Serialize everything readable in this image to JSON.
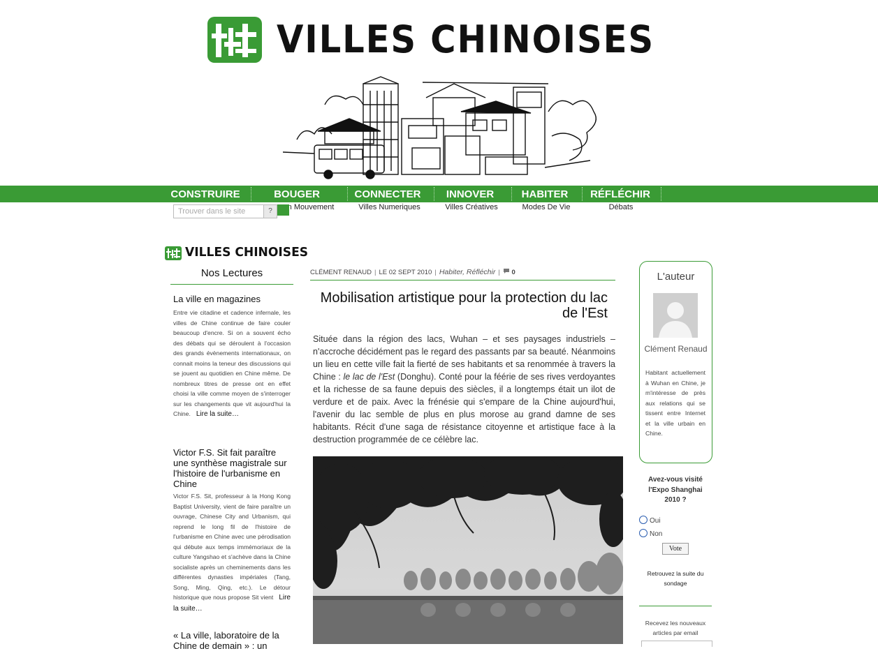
{
  "site": {
    "title": "VILLES CHINOISES",
    "accent": "#3a9b35"
  },
  "nav": {
    "items": [
      {
        "label": "CONSTRUIRE",
        "sub": ""
      },
      {
        "label": "BOUGER",
        "sub": "n Mouvement"
      },
      {
        "label": "CONNECTER",
        "sub": "Villes Numeriques"
      },
      {
        "label": "INNOVER",
        "sub": "Villes Créatives"
      },
      {
        "label": "HABITER",
        "sub": "Modes De Vie"
      },
      {
        "label": "RÉFLÉCHIR",
        "sub": "Débats"
      }
    ]
  },
  "search": {
    "placeholder": "Trouver dans le site",
    "button": "?"
  },
  "sidebar_left": {
    "logo_text": "VILLES CHINOISES",
    "section_title": "Nos Lectures",
    "items": [
      {
        "title": "La ville en magazines",
        "excerpt": "Entre vie citadine et cadence infernale, les villes de Chine continue de faire couler beaucoup d'encre. Si on a souvent écho des débats qui se déroulent à l'occasion des grands évènements internationaux, on connait moins la teneur des discussions qui se jouent au quotidien en Chine même. De nombreux titres de presse ont en effet choisi la ville comme moyen de s'interroger sur les changements que vit aujourd'hui la Chine.",
        "more": "Lire la suite…"
      },
      {
        "title": "Victor F.S. Sit fait paraître une synthèse magistrale sur l'histoire de l'urbanisme en Chine",
        "excerpt": "Victor F.S. Sit, professeur à la Hong Kong Baptist University, vient de faire paraître un ouvrage, Chinese City and Urbanism, qui reprend le long fil de l'histoire de l'urbanisme en Chine avec une pérodisation qui débute aux temps immémoriaux de la culture Yangshao et s'achève dans la Chine socialiste après un cheminements dans les différentes dynasties impériales (Tang, Song, Ming, Qing, etc.). Le détour historique que nous propose Sit vient",
        "more": "Lire la suite…"
      },
      {
        "title": "« La ville, laboratoire de la Chine de demain » : un",
        "excerpt": "",
        "more": ""
      }
    ]
  },
  "article": {
    "author": "CLÉMENT RENAUD",
    "date": "LE 02 SEPT 2010",
    "categories": "Habiter, Réfléchir",
    "comments": "0",
    "title": "Mobilisation artistique pour la protection du lac de l'Est",
    "body_1": "Située dans la région des lacs, Wuhan – et ses paysages industriels – n'accroche décidément  pas le regard des passants par sa beauté. Néanmoins un lieu en cette ville fait la fierté de ses habitants et sa renommée à travers la Chine : ",
    "body_italic": "le lac de l'Est",
    "body_2": " (Donghu). Conté pour la féérie de ses rives verdoyantes et la richesse de sa faune depuis des siècles, il a longtemps était un ilot de verdure et de paix. Avec la frénésie qui s'empare de la Chine aujourd'hui, l'avenir du lac semble de plus en plus morose au grand damne de ses habitants. Récit d'une saga de résistance citoyenne et artistique face à la destruction programmée de ce célèbre lac."
  },
  "sidebar_right": {
    "author_box_title": "L'auteur",
    "author_name": "Clément Renaud",
    "author_bio": "Habitant actuellement à Wuhan en Chine, je m'intéresse de près aux relations qui se tissent entre Internet et la ville urbain en Chine.",
    "poll": {
      "question": "Avez-vous visité l'Expo Shanghai 2010 ?",
      "options": [
        "Oui",
        "Non"
      ],
      "vote": "Vote",
      "results": "Retrouvez la suite du sondage"
    },
    "newsletter": "Recevez les nouveaux articles par email"
  }
}
